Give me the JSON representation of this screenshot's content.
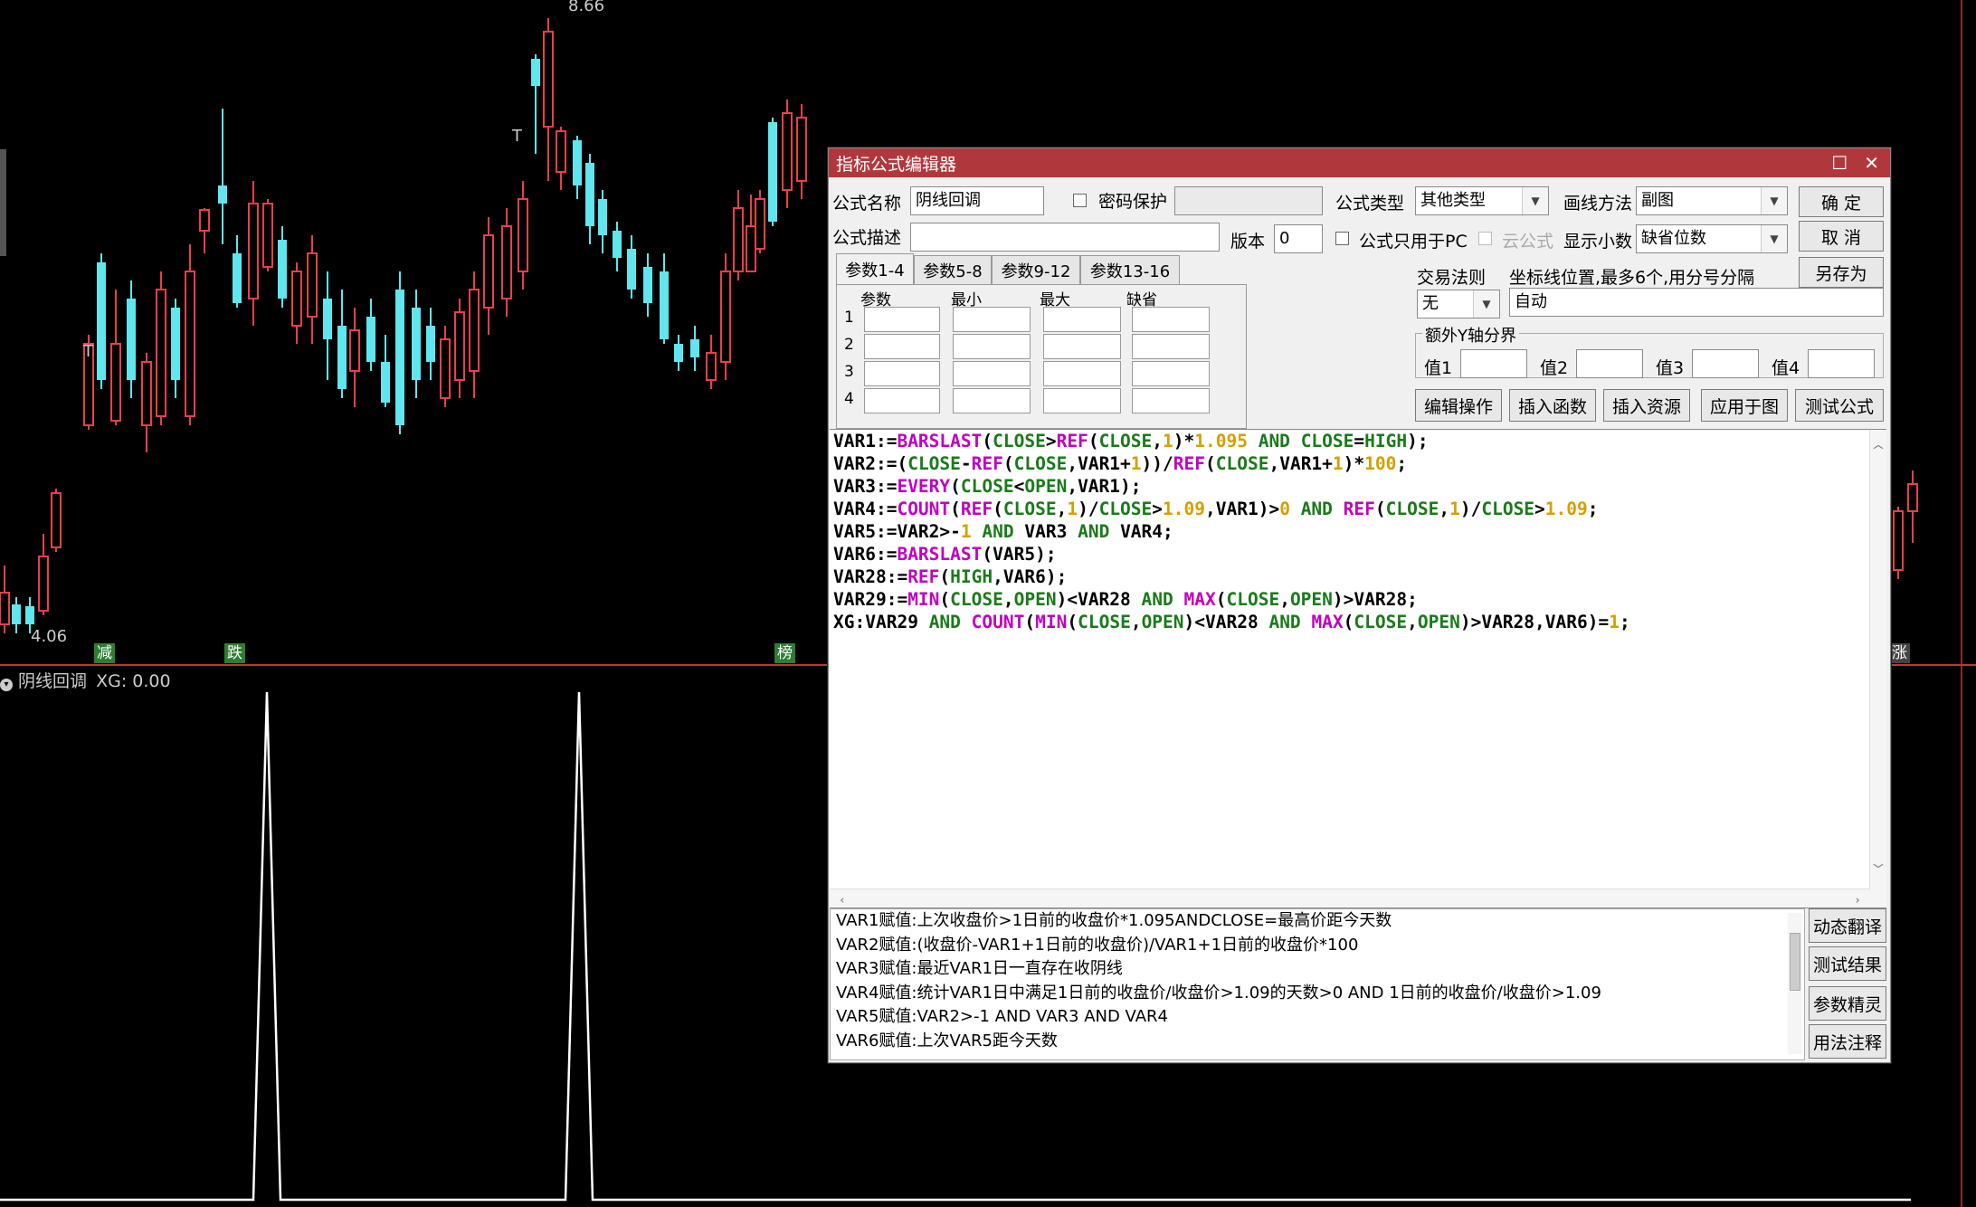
{
  "chart": {
    "high_label": "8.66",
    "low_label": "4.06",
    "t_label": "T",
    "indicator_label": "阴线回调",
    "indicator_value": "XG: 0.00",
    "markers": [
      {
        "label": "减",
        "color": "#2e7d32"
      },
      {
        "label": "跌",
        "color": "#2e7d32"
      },
      {
        "label": "榜",
        "color": "#2e7d32"
      },
      {
        "label": "涨",
        "color": "#444"
      }
    ],
    "colors": {
      "up": "#e8404a",
      "down": "#5fe6ee",
      "signal": "#ffffff",
      "divider": "#c0363c"
    }
  },
  "dialog": {
    "title": "指标公式编辑器",
    "formula_name_label": "公式名称",
    "formula_name_value": "阴线回调",
    "password_label": "密码保护",
    "formula_type_label": "公式类型",
    "formula_type_value": "其他类型",
    "draw_method_label": "画线方法",
    "draw_method_value": "副图",
    "ok_button": "确  定",
    "cancel_button": "取  消",
    "save_as_button": "另存为",
    "description_label": "公式描述",
    "version_label": "版本",
    "version_value": "0",
    "pc_only_label": "公式只用于PC",
    "cloud_label": "云公式",
    "decimals_label": "显示小数",
    "decimals_value": "缺省位数",
    "tabs": [
      "参数1-4",
      "参数5-8",
      "参数9-12",
      "参数13-16"
    ],
    "param_headers": [
      "参数",
      "最小",
      "最大",
      "缺省"
    ],
    "param_rows": [
      "1",
      "2",
      "3",
      "4"
    ],
    "trade_rule_label": "交易法则",
    "trade_rule_value": "无",
    "axis_position_label": "坐标线位置,最多6个,用分号分隔",
    "axis_position_value": "自动",
    "extra_y_label": "额外Y轴分界",
    "extra_y_values": [
      "值1",
      "值2",
      "值3",
      "值4"
    ],
    "action_buttons": [
      "编辑操作",
      "插入函数",
      "插入资源",
      "应用于图",
      "测试公式"
    ],
    "explain_lines": [
      "VAR1赋值:上次收盘价>1日前的收盘价*1.095ANDCLOSE=最高价距今天数",
      "VAR2赋值:(收盘价-VAR1+1日前的收盘价)/VAR1+1日前的收盘价*100",
      "VAR3赋值:最近VAR1日一直存在收阴线",
      "VAR4赋值:统计VAR1日中满足1日前的收盘价/收盘价>1.09的天数>0 AND 1日前的收盘价/收盘价>1.09",
      "VAR5赋值:VAR2>-1 AND VAR3 AND VAR4",
      "VAR6赋值:上次VAR5距今天数"
    ],
    "side_buttons": [
      "动态翻译",
      "测试结果",
      "参数精灵",
      "用法注释"
    ]
  }
}
